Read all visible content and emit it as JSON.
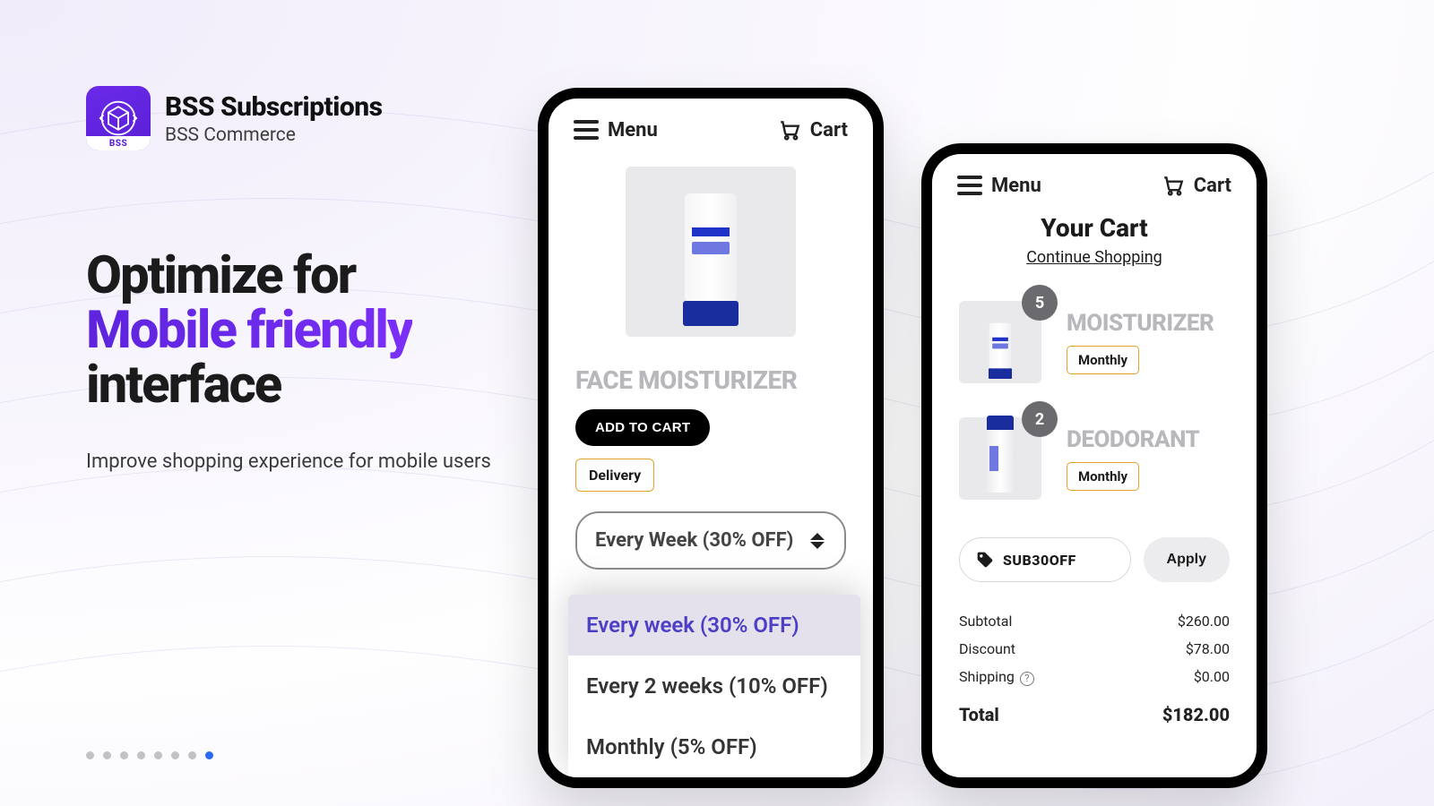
{
  "brand": {
    "title": "BSS Subscriptions",
    "subtitle": "BSS Commerce",
    "badge": "BSS"
  },
  "hero": {
    "line1": "Optimize for",
    "accent": "Mobile friendly",
    "line3": "interface",
    "sub": "Improve shopping experience for mobile users"
  },
  "carousel": {
    "total": 8,
    "active_index": 7
  },
  "phone_product": {
    "menu_label": "Menu",
    "cart_label": "Cart",
    "title": "FACE MOISTURIZER",
    "add_btn": "ADD TO CART",
    "delivery_tag": "Delivery",
    "select_value": "Every Week (30% OFF)",
    "options": [
      "Every week (30% OFF)",
      "Every 2 weeks (10% OFF)",
      "Monthly (5% OFF)"
    ],
    "selected_option_index": 0
  },
  "phone_cart": {
    "menu_label": "Menu",
    "cart_label": "Cart",
    "heading": "Your Cart",
    "continue": "Continue Shopping",
    "items": [
      {
        "name": "MOISTURIZER",
        "qty": "5",
        "tag": "Monthly"
      },
      {
        "name": "DEODORANT",
        "qty": "2",
        "tag": "Monthly"
      }
    ],
    "promo": {
      "code": "SUB30OFF",
      "apply": "Apply"
    },
    "summary": {
      "subtotal_label": "Subtotal",
      "subtotal": "$260.00",
      "discount_label": "Discount",
      "discount": "$78.00",
      "shipping_label": "Shipping",
      "shipping": "$0.00",
      "total_label": "Total",
      "total": "$182.00"
    }
  }
}
